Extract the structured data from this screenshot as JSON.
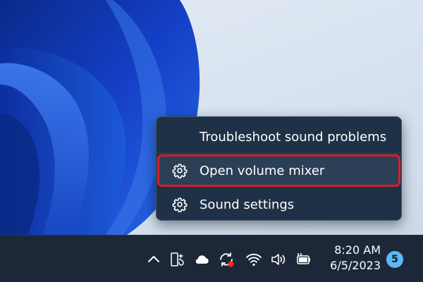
{
  "context_menu": {
    "items": [
      {
        "label": "Troubleshoot sound problems",
        "icon": "none"
      },
      {
        "label": "Open volume mixer",
        "icon": "gear-icon",
        "highlighted": true
      },
      {
        "label": "Sound settings",
        "icon": "gear-icon"
      }
    ]
  },
  "taskbar": {
    "tray_icons": [
      "chevron-up-icon",
      "language-icon",
      "cloud-icon",
      "sync-icon",
      "wifi-icon",
      "volume-icon",
      "battery-icon"
    ],
    "clock": {
      "time": "8:20 AM",
      "date": "6/5/2023"
    },
    "notification_count": "5"
  },
  "colors": {
    "highlight_border": "#d81f26",
    "menu_background": "#1e3147",
    "taskbar_background": "#1c2738",
    "badge": "#5fb6f5",
    "sync_status_dot": "#ff2a2a"
  }
}
